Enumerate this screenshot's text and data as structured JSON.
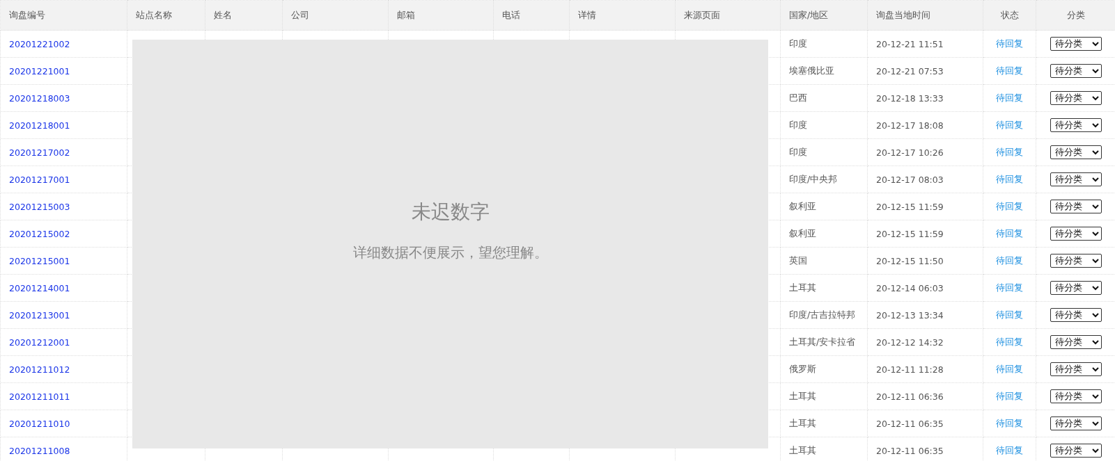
{
  "table": {
    "columns": [
      "询盘编号",
      "站点名称",
      "姓名",
      "公司",
      "邮箱",
      "电话",
      "详情",
      "来源页面",
      "国家/地区",
      "询盘当地时间",
      "状态",
      "分类"
    ],
    "rows": [
      {
        "id": "20201221002",
        "country": "印度",
        "time": "20-12-21 11:51",
        "status": "待回复",
        "category": "待分类"
      },
      {
        "id": "20201221001",
        "country": "埃塞俄比亚",
        "time": "20-12-21 07:53",
        "status": "待回复",
        "category": "待分类"
      },
      {
        "id": "20201218003",
        "country": "巴西",
        "time": "20-12-18 13:33",
        "status": "待回复",
        "category": "待分类"
      },
      {
        "id": "20201218001",
        "country": "印度",
        "time": "20-12-17 18:08",
        "status": "待回复",
        "category": "待分类"
      },
      {
        "id": "20201217002",
        "country": "印度",
        "time": "20-12-17 10:26",
        "status": "待回复",
        "category": "待分类"
      },
      {
        "id": "20201217001",
        "country": "印度/中央邦",
        "time": "20-12-17 08:03",
        "status": "待回复",
        "category": "待分类"
      },
      {
        "id": "20201215003",
        "country": "叙利亚",
        "time": "20-12-15 11:59",
        "status": "待回复",
        "category": "待分类"
      },
      {
        "id": "20201215002",
        "country": "叙利亚",
        "time": "20-12-15 11:59",
        "status": "待回复",
        "category": "待分类"
      },
      {
        "id": "20201215001",
        "country": "英国",
        "time": "20-12-15 11:50",
        "status": "待回复",
        "category": "待分类"
      },
      {
        "id": "20201214001",
        "country": "土耳其",
        "time": "20-12-14 06:03",
        "status": "待回复",
        "category": "待分类"
      },
      {
        "id": "20201213001",
        "country": "印度/古吉拉特邦",
        "time": "20-12-13 13:34",
        "status": "待回复",
        "category": "待分类"
      },
      {
        "id": "20201212001",
        "country": "土耳其/安卡拉省",
        "time": "20-12-12 14:32",
        "status": "待回复",
        "category": "待分类"
      },
      {
        "id": "20201211012",
        "country": "俄罗斯",
        "time": "20-12-11 11:28",
        "status": "待回复",
        "category": "待分类"
      },
      {
        "id": "20201211011",
        "country": "土耳其",
        "time": "20-12-11 06:36",
        "status": "待回复",
        "category": "待分类"
      },
      {
        "id": "20201211010",
        "country": "土耳其",
        "time": "20-12-11 06:35",
        "status": "待回复",
        "category": "待分类"
      },
      {
        "id": "20201211008",
        "country": "土耳其",
        "time": "20-12-11 06:35",
        "status": "待回复",
        "category": "待分类"
      }
    ]
  },
  "overlay": {
    "title": "未迟数字",
    "message": "详细数据不便展示，望您理解。"
  }
}
